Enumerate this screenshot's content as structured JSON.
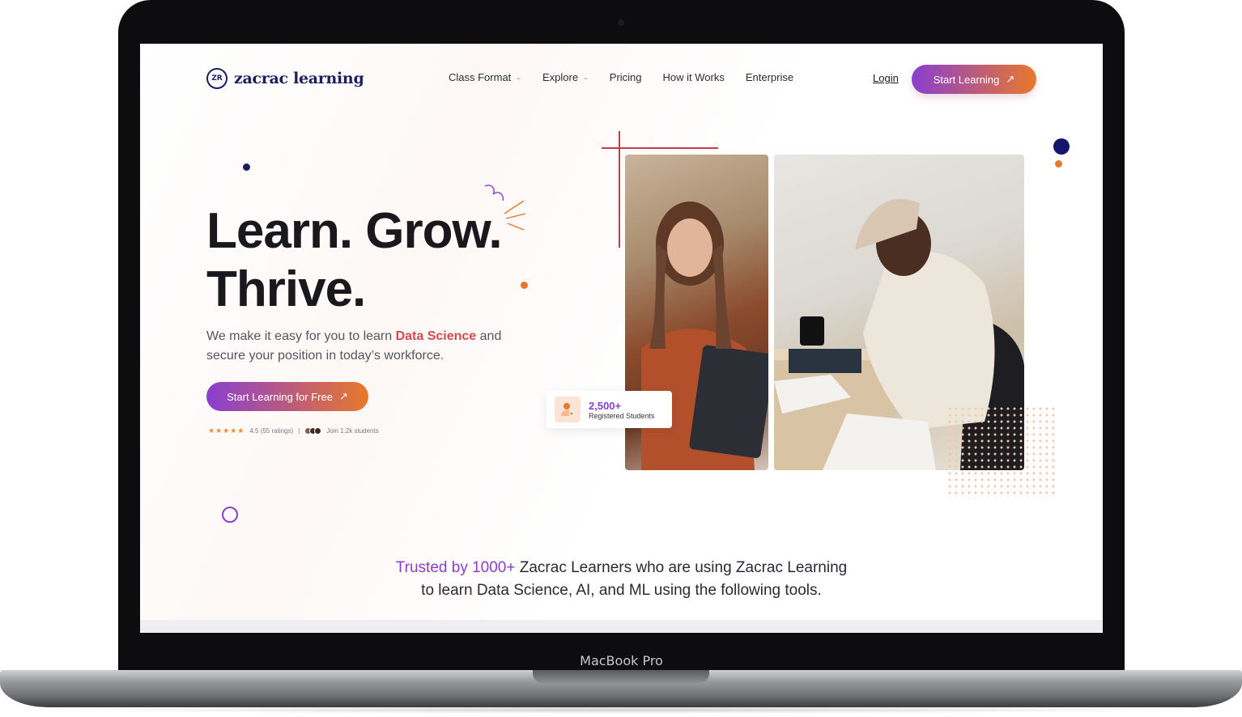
{
  "device": {
    "label": "MacBook Pro"
  },
  "brand": {
    "logo_mark": "ZR",
    "name": "zacrac learning"
  },
  "nav": {
    "items": [
      {
        "label": "Class Format",
        "has_dropdown": true
      },
      {
        "label": "Explore",
        "has_dropdown": true
      },
      {
        "label": "Pricing",
        "has_dropdown": false
      },
      {
        "label": "How it Works",
        "has_dropdown": false
      },
      {
        "label": "Enterprise",
        "has_dropdown": false
      }
    ],
    "chevron": "⌄",
    "login": "Login",
    "cta": "Start Learning"
  },
  "hero": {
    "title_line1": "Learn. Grow.",
    "title_line2": "Thrive.",
    "sub_before": "We make it easy for you to learn ",
    "sub_highlight": "Data Science",
    "sub_after": " and secure your position in today’s workforce.",
    "cta": "Start Learning for Free",
    "stars": "★★★★★",
    "rating_text": "4.5 (55 ratings)",
    "separator": "|",
    "join_text": "Join 1.2k students"
  },
  "stat_card": {
    "number": "2,500+",
    "label": "Registered Students"
  },
  "trusted": {
    "highlight": "Trusted by 1000+",
    "text_line1": " Zacrac Learners who are using Zacrac Learning",
    "text_line2": "to learn Data Science, AI, and ML using the following tools."
  },
  "icons": {
    "arrow": "↗",
    "user_plus": "user-plus-icon"
  },
  "colors": {
    "accent_purple": "#8a3ed0",
    "accent_orange": "#e8782c",
    "brand_navy": "#1b1f5e",
    "highlight_red": "#d6484a"
  }
}
